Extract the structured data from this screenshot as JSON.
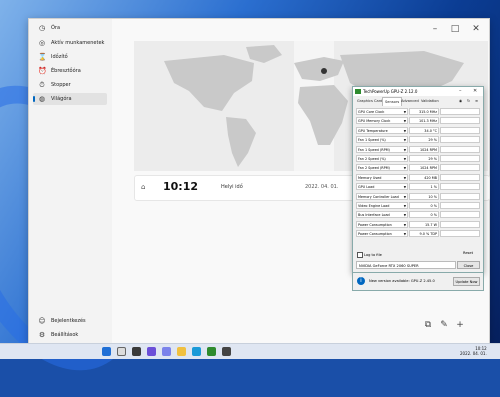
{
  "clock_app": {
    "title": "Óra",
    "nav_items": [
      {
        "label": "Óra",
        "icon": "clock-app-icon"
      },
      {
        "label": "Aktív munkamenetek",
        "icon": "focus-icon"
      },
      {
        "label": "Időzítő",
        "icon": "timer-icon"
      },
      {
        "label": "Ébresztőóra",
        "icon": "alarm-icon"
      },
      {
        "label": "Stopper",
        "icon": "stopwatch-icon"
      },
      {
        "label": "Világóra",
        "icon": "globe-icon"
      }
    ],
    "active_nav": "Világóra",
    "footer_items": [
      {
        "label": "Bejelentkezés",
        "icon": "person-icon"
      },
      {
        "label": "Beállítások",
        "icon": "gear-icon"
      }
    ],
    "world_clock": {
      "time": "10:12",
      "label": "Helyi idő",
      "date": "2022. 04. 01."
    }
  },
  "gpuz": {
    "title": "TechPowerUp GPU-Z 2.12.0",
    "tabs": [
      "Graphics Card",
      "Sensors",
      "Advanced",
      "Validation"
    ],
    "active_tab": "Sensors",
    "sensors": [
      {
        "name": "GPU Core Clock",
        "value": "315.0 MHz"
      },
      {
        "name": "GPU Memory Clock",
        "value": "101.3 MHz"
      },
      {
        "name": "GPU Temperature",
        "value": "34.0 °C"
      },
      {
        "name": "Fan 1 Speed (%)",
        "value": "29 %"
      },
      {
        "name": "Fan 1 Speed (RPM)",
        "value": "1024 RPM"
      },
      {
        "name": "Fan 2 Speed (%)",
        "value": "29 %"
      },
      {
        "name": "Fan 2 Speed (RPM)",
        "value": "1024 RPM"
      },
      {
        "name": "Memory Used",
        "value": "420 MB"
      },
      {
        "name": "GPU Load",
        "value": "1 %"
      },
      {
        "name": "Memory Controller Load",
        "value": "10 %"
      },
      {
        "name": "Video Engine Load",
        "value": "0 %"
      },
      {
        "name": "Bus Interface Load",
        "value": "0 %"
      },
      {
        "name": "Power Consumption",
        "value": "15.7 W"
      },
      {
        "name": "Power Consumption",
        "value": "9.0 % TDP"
      }
    ],
    "log_label": "Log to file",
    "reset_label": "Reset",
    "device": "NVIDIA GeForce RTX 2060 SUPER",
    "close_label": "Close",
    "notice": "New version available: GPU-Z 2.45.0",
    "update_label": "Update Now"
  },
  "taskbar": {
    "time": "10:12",
    "date": "2022. 04. 01."
  },
  "colors": {
    "accent": "#0067c0",
    "graph_red": "#cc0000"
  }
}
